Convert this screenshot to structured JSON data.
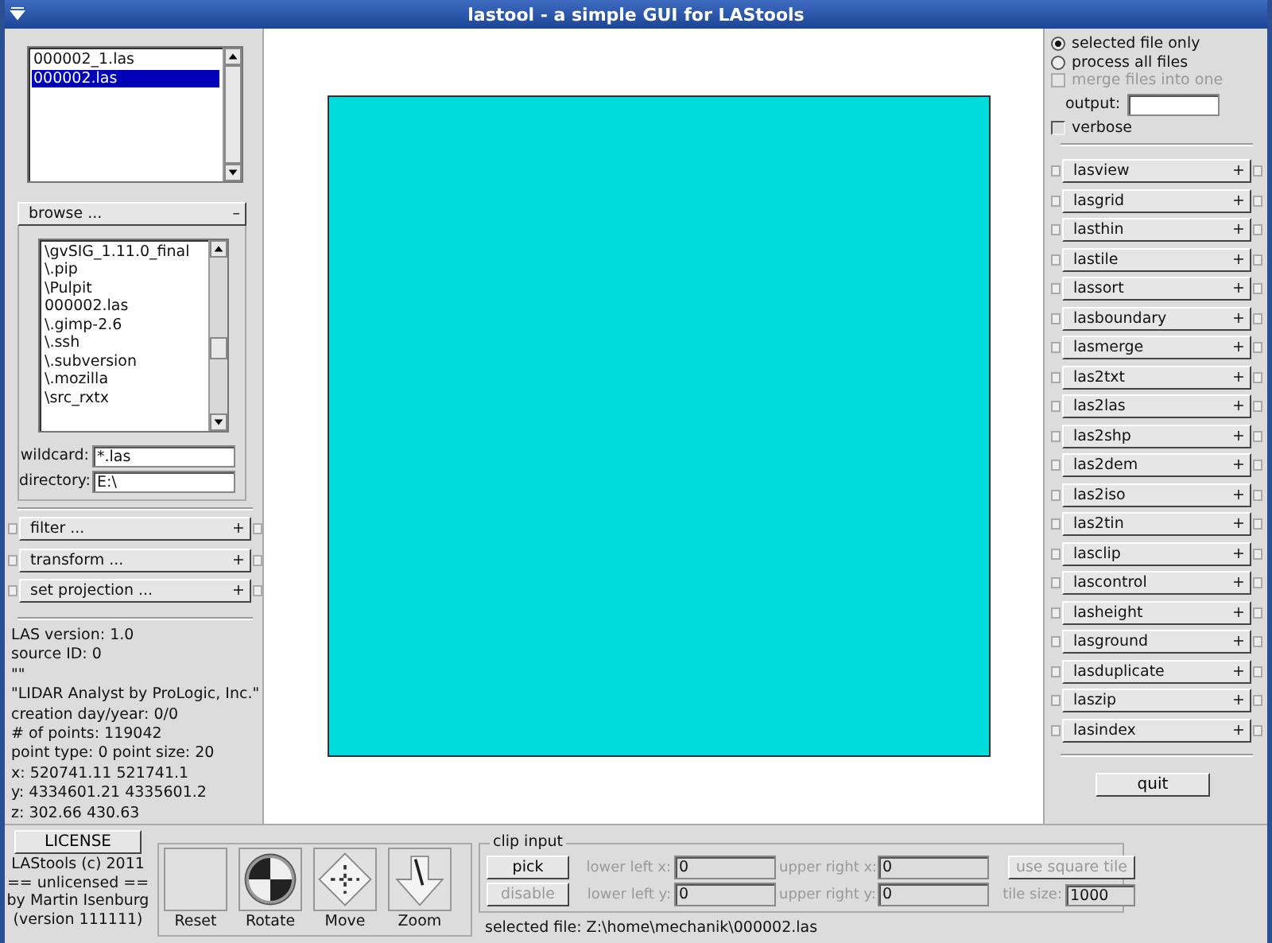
{
  "window": {
    "title": "lastool - a simple GUI for LAStools"
  },
  "files": [
    {
      "name": "000002_1.las",
      "selected": false
    },
    {
      "name": "000002.las",
      "selected": true
    }
  ],
  "browse": {
    "label": "browse ...",
    "toggle": "–",
    "items": [
      "\\gvSIG_1.11.0_final",
      "\\.pip",
      "\\Pulpit",
      "000002.las",
      "\\.gimp-2.6",
      "\\.ssh",
      "\\.subversion",
      "\\.mozilla",
      "\\src_rxtx"
    ]
  },
  "wildcard": {
    "label": "wildcard:",
    "value": "*.las"
  },
  "directory": {
    "label": "directory:",
    "value": "E:\\"
  },
  "sections": [
    {
      "label": "filter ...",
      "toggle": "+"
    },
    {
      "label": "transform ...",
      "toggle": "+"
    },
    {
      "label": "set projection ...",
      "toggle": "+"
    }
  ],
  "info": [
    "LAS version: 1.0",
    "source ID: 0",
    "\"\"",
    "\"LIDAR Analyst by ProLogic, Inc.\"",
    "creation day/year: 0/0",
    "# of points: 119042",
    "point type: 0 point size: 20",
    "x: 520741.11 521741.1",
    "y: 4334601.21 4335601.2",
    "z: 302.66 430.63"
  ],
  "modes": [
    {
      "label": "selected file only",
      "selected": true
    },
    {
      "label": "process all files",
      "selected": false
    }
  ],
  "merge": {
    "label": "merge files into one",
    "checked": false,
    "disabled": true
  },
  "output": {
    "label": "output:"
  },
  "verbose": {
    "label": "verbose",
    "checked": false
  },
  "tools": [
    {
      "label": "lasview",
      "toggle": "+"
    },
    {
      "label": "lasgrid",
      "toggle": "+"
    },
    {
      "label": "lasthin",
      "toggle": "+"
    },
    {
      "label": "lastile",
      "toggle": "+"
    },
    {
      "label": "lassort",
      "toggle": "+"
    },
    {
      "label": "lasboundary",
      "toggle": "+"
    },
    {
      "label": "lasmerge",
      "toggle": "+"
    },
    {
      "label": "las2txt",
      "toggle": "+"
    },
    {
      "label": "las2las",
      "toggle": "+"
    },
    {
      "label": "las2shp",
      "toggle": "+"
    },
    {
      "label": "las2dem",
      "toggle": "+"
    },
    {
      "label": "las2iso",
      "toggle": "+"
    },
    {
      "label": "las2tin",
      "toggle": "+"
    },
    {
      "label": "lasclip",
      "toggle": "+"
    },
    {
      "label": "lascontrol",
      "toggle": "+"
    },
    {
      "label": "lasheight",
      "toggle": "+"
    },
    {
      "label": "lasground",
      "toggle": "+"
    },
    {
      "label": "lasduplicate",
      "toggle": "+"
    },
    {
      "label": "laszip",
      "toggle": "+"
    },
    {
      "label": "lasindex",
      "toggle": "+"
    }
  ],
  "quit": "quit",
  "license": "LICENSE",
  "credits": [
    "LAStools (c) 2011",
    "== unlicensed ==",
    "by Martin Isenburg",
    "(version 111111)"
  ],
  "view_buttons": [
    {
      "label": "Reset",
      "kind": "reset"
    },
    {
      "label": "Rotate",
      "kind": "rotate"
    },
    {
      "label": "Move",
      "kind": "move"
    },
    {
      "label": "Zoom",
      "kind": "zoom"
    }
  ],
  "clip_input": {
    "title": "clip input",
    "buttons": [
      {
        "label": "pick",
        "disabled": false
      },
      {
        "label": "disable",
        "disabled": true
      }
    ],
    "fields": [
      {
        "label": "lower left x:",
        "value": "0"
      },
      {
        "label": "lower left y:",
        "value": "0"
      },
      {
        "label": "upper right x:",
        "value": "0"
      },
      {
        "label": "upper right y:",
        "value": "0"
      }
    ],
    "square": {
      "label": "use square tile",
      "disabled": true
    },
    "tile_size": {
      "label": "tile size:",
      "value": "1000"
    }
  },
  "selected_file": "selected file: Z:\\home\\mechanik\\000002.las"
}
